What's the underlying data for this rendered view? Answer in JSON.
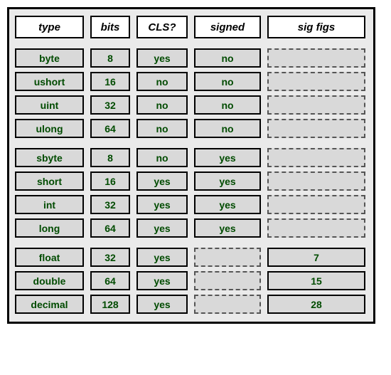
{
  "headers": {
    "type": "type",
    "bits": "bits",
    "cls": "CLS?",
    "signed": "signed",
    "sig": "sig figs"
  },
  "rows": [
    {
      "type": "byte",
      "bits": "8",
      "cls": "yes",
      "signed": "no",
      "sig": null,
      "group_end": false
    },
    {
      "type": "ushort",
      "bits": "16",
      "cls": "no",
      "signed": "no",
      "sig": null,
      "group_end": false
    },
    {
      "type": "uint",
      "bits": "32",
      "cls": "no",
      "signed": "no",
      "sig": null,
      "group_end": false
    },
    {
      "type": "ulong",
      "bits": "64",
      "cls": "no",
      "signed": "no",
      "sig": null,
      "group_end": true
    },
    {
      "type": "sbyte",
      "bits": "8",
      "cls": "no",
      "signed": "yes",
      "sig": null,
      "group_end": false
    },
    {
      "type": "short",
      "bits": "16",
      "cls": "yes",
      "signed": "yes",
      "sig": null,
      "group_end": false
    },
    {
      "type": "int",
      "bits": "32",
      "cls": "yes",
      "signed": "yes",
      "sig": null,
      "group_end": false
    },
    {
      "type": "long",
      "bits": "64",
      "cls": "yes",
      "signed": "yes",
      "sig": null,
      "group_end": true
    },
    {
      "type": "float",
      "bits": "32",
      "cls": "yes",
      "signed": null,
      "sig": "7",
      "group_end": false
    },
    {
      "type": "double",
      "bits": "64",
      "cls": "yes",
      "signed": null,
      "sig": "15",
      "group_end": false
    },
    {
      "type": "decimal",
      "bits": "128",
      "cls": "yes",
      "signed": null,
      "sig": "28",
      "group_end": false
    }
  ]
}
